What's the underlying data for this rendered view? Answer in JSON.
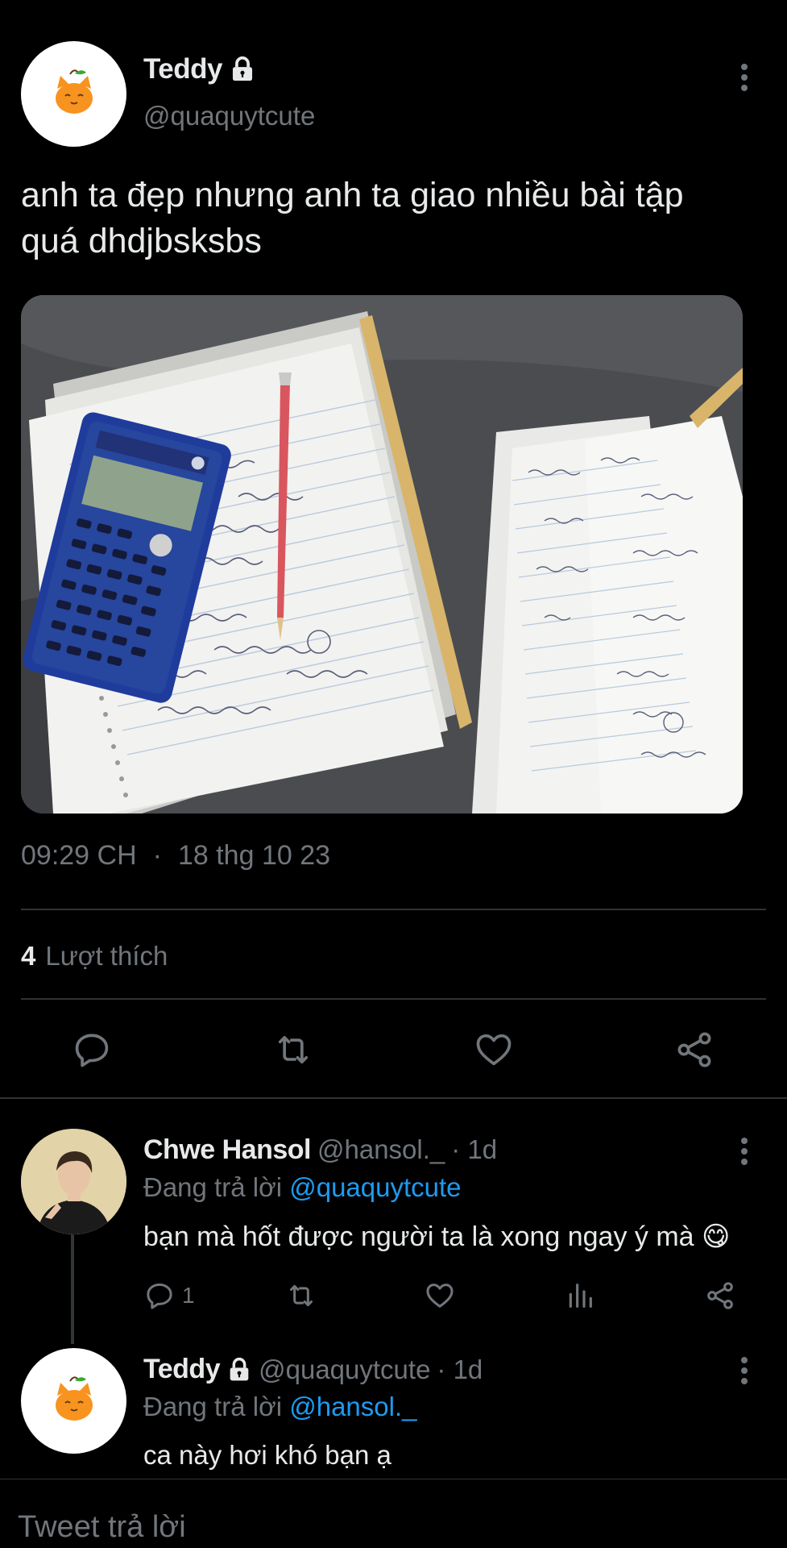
{
  "main_tweet": {
    "display_name": "Teddy",
    "handle": "@quaquytcute",
    "text_line1": "anh ta đẹp nhưng anh ta giao nhiều bài tập",
    "text_line2": "quá dhdjbsksbs",
    "time": "09:29 CH",
    "date": "18 thg 10 23",
    "likes_count": "4",
    "likes_label": "Lượt thích"
  },
  "reply1": {
    "display_name": "Chwe Hansol",
    "handle": "@hansol._",
    "age": "· 1d",
    "replying_prefix": "Đang trả lời",
    "replying_to": "@quaquytcute",
    "text": "bạn mà hốt được người ta là xong ngay ý mà",
    "emoji": "😋",
    "reply_count": "1"
  },
  "reply2": {
    "display_name": "Teddy",
    "handle": "@quaquytcute",
    "age": "· 1d",
    "replying_prefix": "Đang trả lời",
    "replying_to": "@hansol._",
    "text": "ca này hơi khó bạn ạ"
  },
  "composer": {
    "placeholder": "Tweet trả lời"
  },
  "colors": {
    "background": "#000000",
    "text": "#e7e9ea",
    "muted": "#71767b",
    "link": "#1d9bf0",
    "divider": "#2f3336"
  },
  "icons": [
    "lock-icon",
    "more-icon",
    "reply-icon",
    "retweet-icon",
    "like-icon",
    "share-icon",
    "views-icon"
  ]
}
